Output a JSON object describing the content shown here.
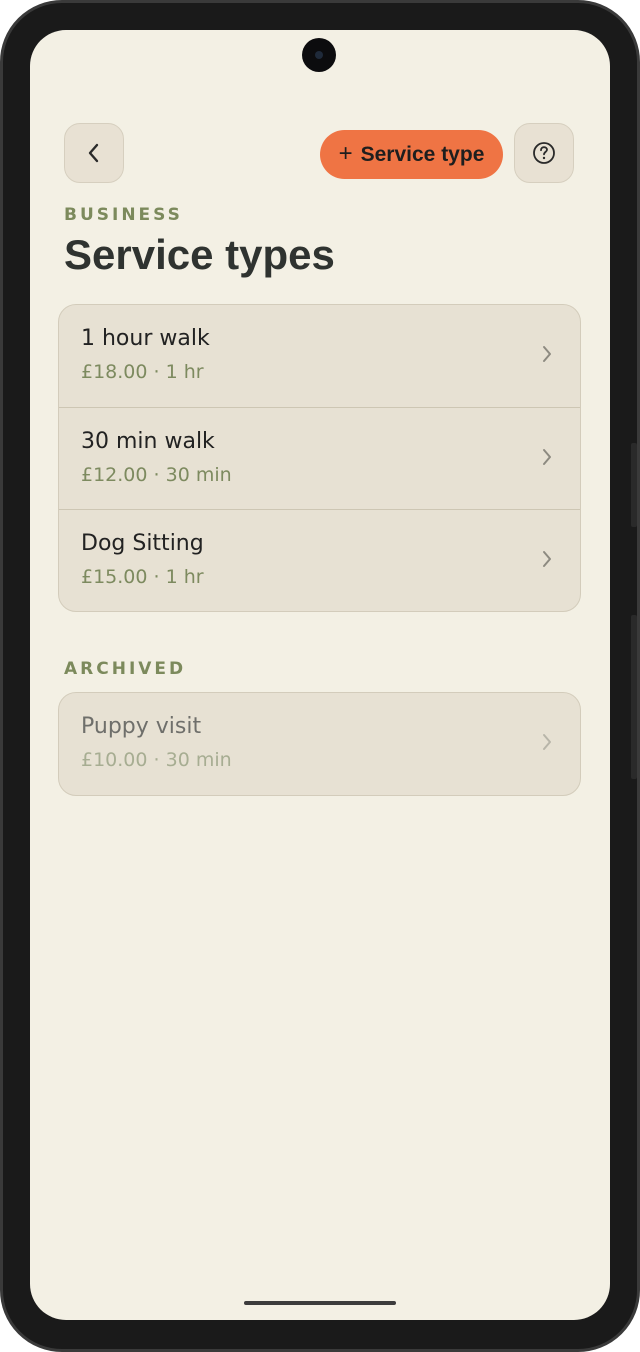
{
  "header": {
    "back_icon": "chevron-left-icon",
    "add_button_icon": "plus-icon",
    "add_button_label": "Service type",
    "help_icon": "help-circle-icon"
  },
  "section_label": "BUSINESS",
  "title": "Service types",
  "services": [
    {
      "name": "1 hour walk",
      "details": "£18.00 · 1 hr"
    },
    {
      "name": "30 min walk",
      "details": "£12.00 · 30 min"
    },
    {
      "name": "Dog Sitting",
      "details": "£15.00 · 1 hr"
    }
  ],
  "archived_label": "ARCHIVED",
  "archived_services": [
    {
      "name": "Puppy visit",
      "details": "£10.00 · 30 min"
    }
  ],
  "colors": {
    "background": "#f3f0e4",
    "accent": "#ef7444",
    "card": "#e7e1d3",
    "label_green": "#7c8a5c"
  }
}
